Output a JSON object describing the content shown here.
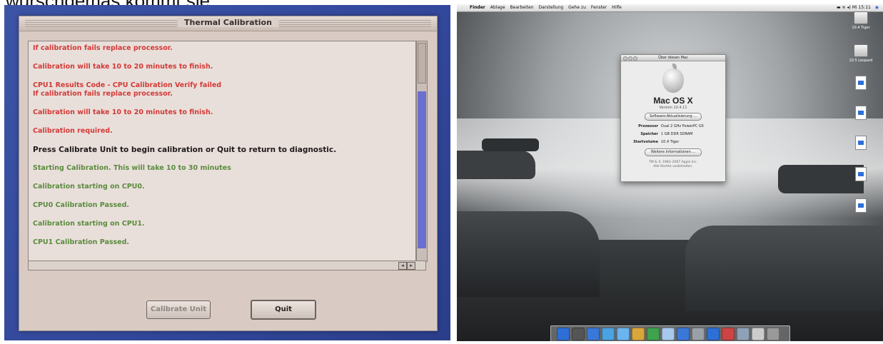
{
  "caption": "wurschdemas kommt sie:",
  "thermal": {
    "title": "Thermal Calibration",
    "log_lines": [
      {
        "text": "If calibration fails replace processor.",
        "color": "red"
      },
      {
        "text": "Calibration will take 10 to 20 minutes to finish.",
        "color": "red"
      },
      {
        "text": "CPU1 Results Code - CPU Calibration Verify failed\nIf calibration fails replace processor.",
        "color": "red"
      },
      {
        "text": "Calibration will take 10 to 20 minutes to finish.",
        "color": "red"
      },
      {
        "text": "Calibration required.",
        "color": "red"
      },
      {
        "text": "Press Calibrate Unit to begin calibration or Quit to return to diagnostic.",
        "color": "black"
      },
      {
        "text": "Starting Calibration. This will take 10 to 30 minutes",
        "color": "green"
      },
      {
        "text": "Calibration starting on CPU0.",
        "color": "green"
      },
      {
        "text": "CPU0 Calibration Passed.",
        "color": "green"
      },
      {
        "text": "Calibration starting on CPU1.",
        "color": "green"
      },
      {
        "text": "CPU1 Calibration Passed.",
        "color": "green"
      }
    ],
    "buttons": {
      "calibrate": "Calibrate Unit",
      "quit": "Quit"
    }
  },
  "mac": {
    "menubar": {
      "items": [
        "Finder",
        "Ablage",
        "Bearbeiten",
        "Darstellung",
        "Gehe zu",
        "Fenster",
        "Hilfe"
      ],
      "clock": "Mi 15:11"
    },
    "about": {
      "window_title": "Über diesen Mac",
      "os_name": "Mac OS X",
      "version": "Version 10.4.11",
      "update_button": "Software-Aktualisierung ...",
      "rows": [
        {
          "label": "Prozessor",
          "value": "Dual 2 GHz PowerPC G5"
        },
        {
          "label": "Speicher",
          "value": "1 GB DDR SDRAM"
        },
        {
          "label": "Startvolume",
          "value": "10.4 Tiger"
        }
      ],
      "more_button": "Weitere Informationen ...",
      "footer": "TM & © 1983–2007 Apple Inc.\nAlle Rechte vorbehalten."
    },
    "desktop_icons": [
      "10.4 Tiger",
      "10.5 Leopard",
      "",
      "",
      "",
      "",
      ""
    ]
  },
  "colors": {
    "red": "#d23a38",
    "green": "#5b8b3f",
    "black": "#1f1a1a"
  }
}
